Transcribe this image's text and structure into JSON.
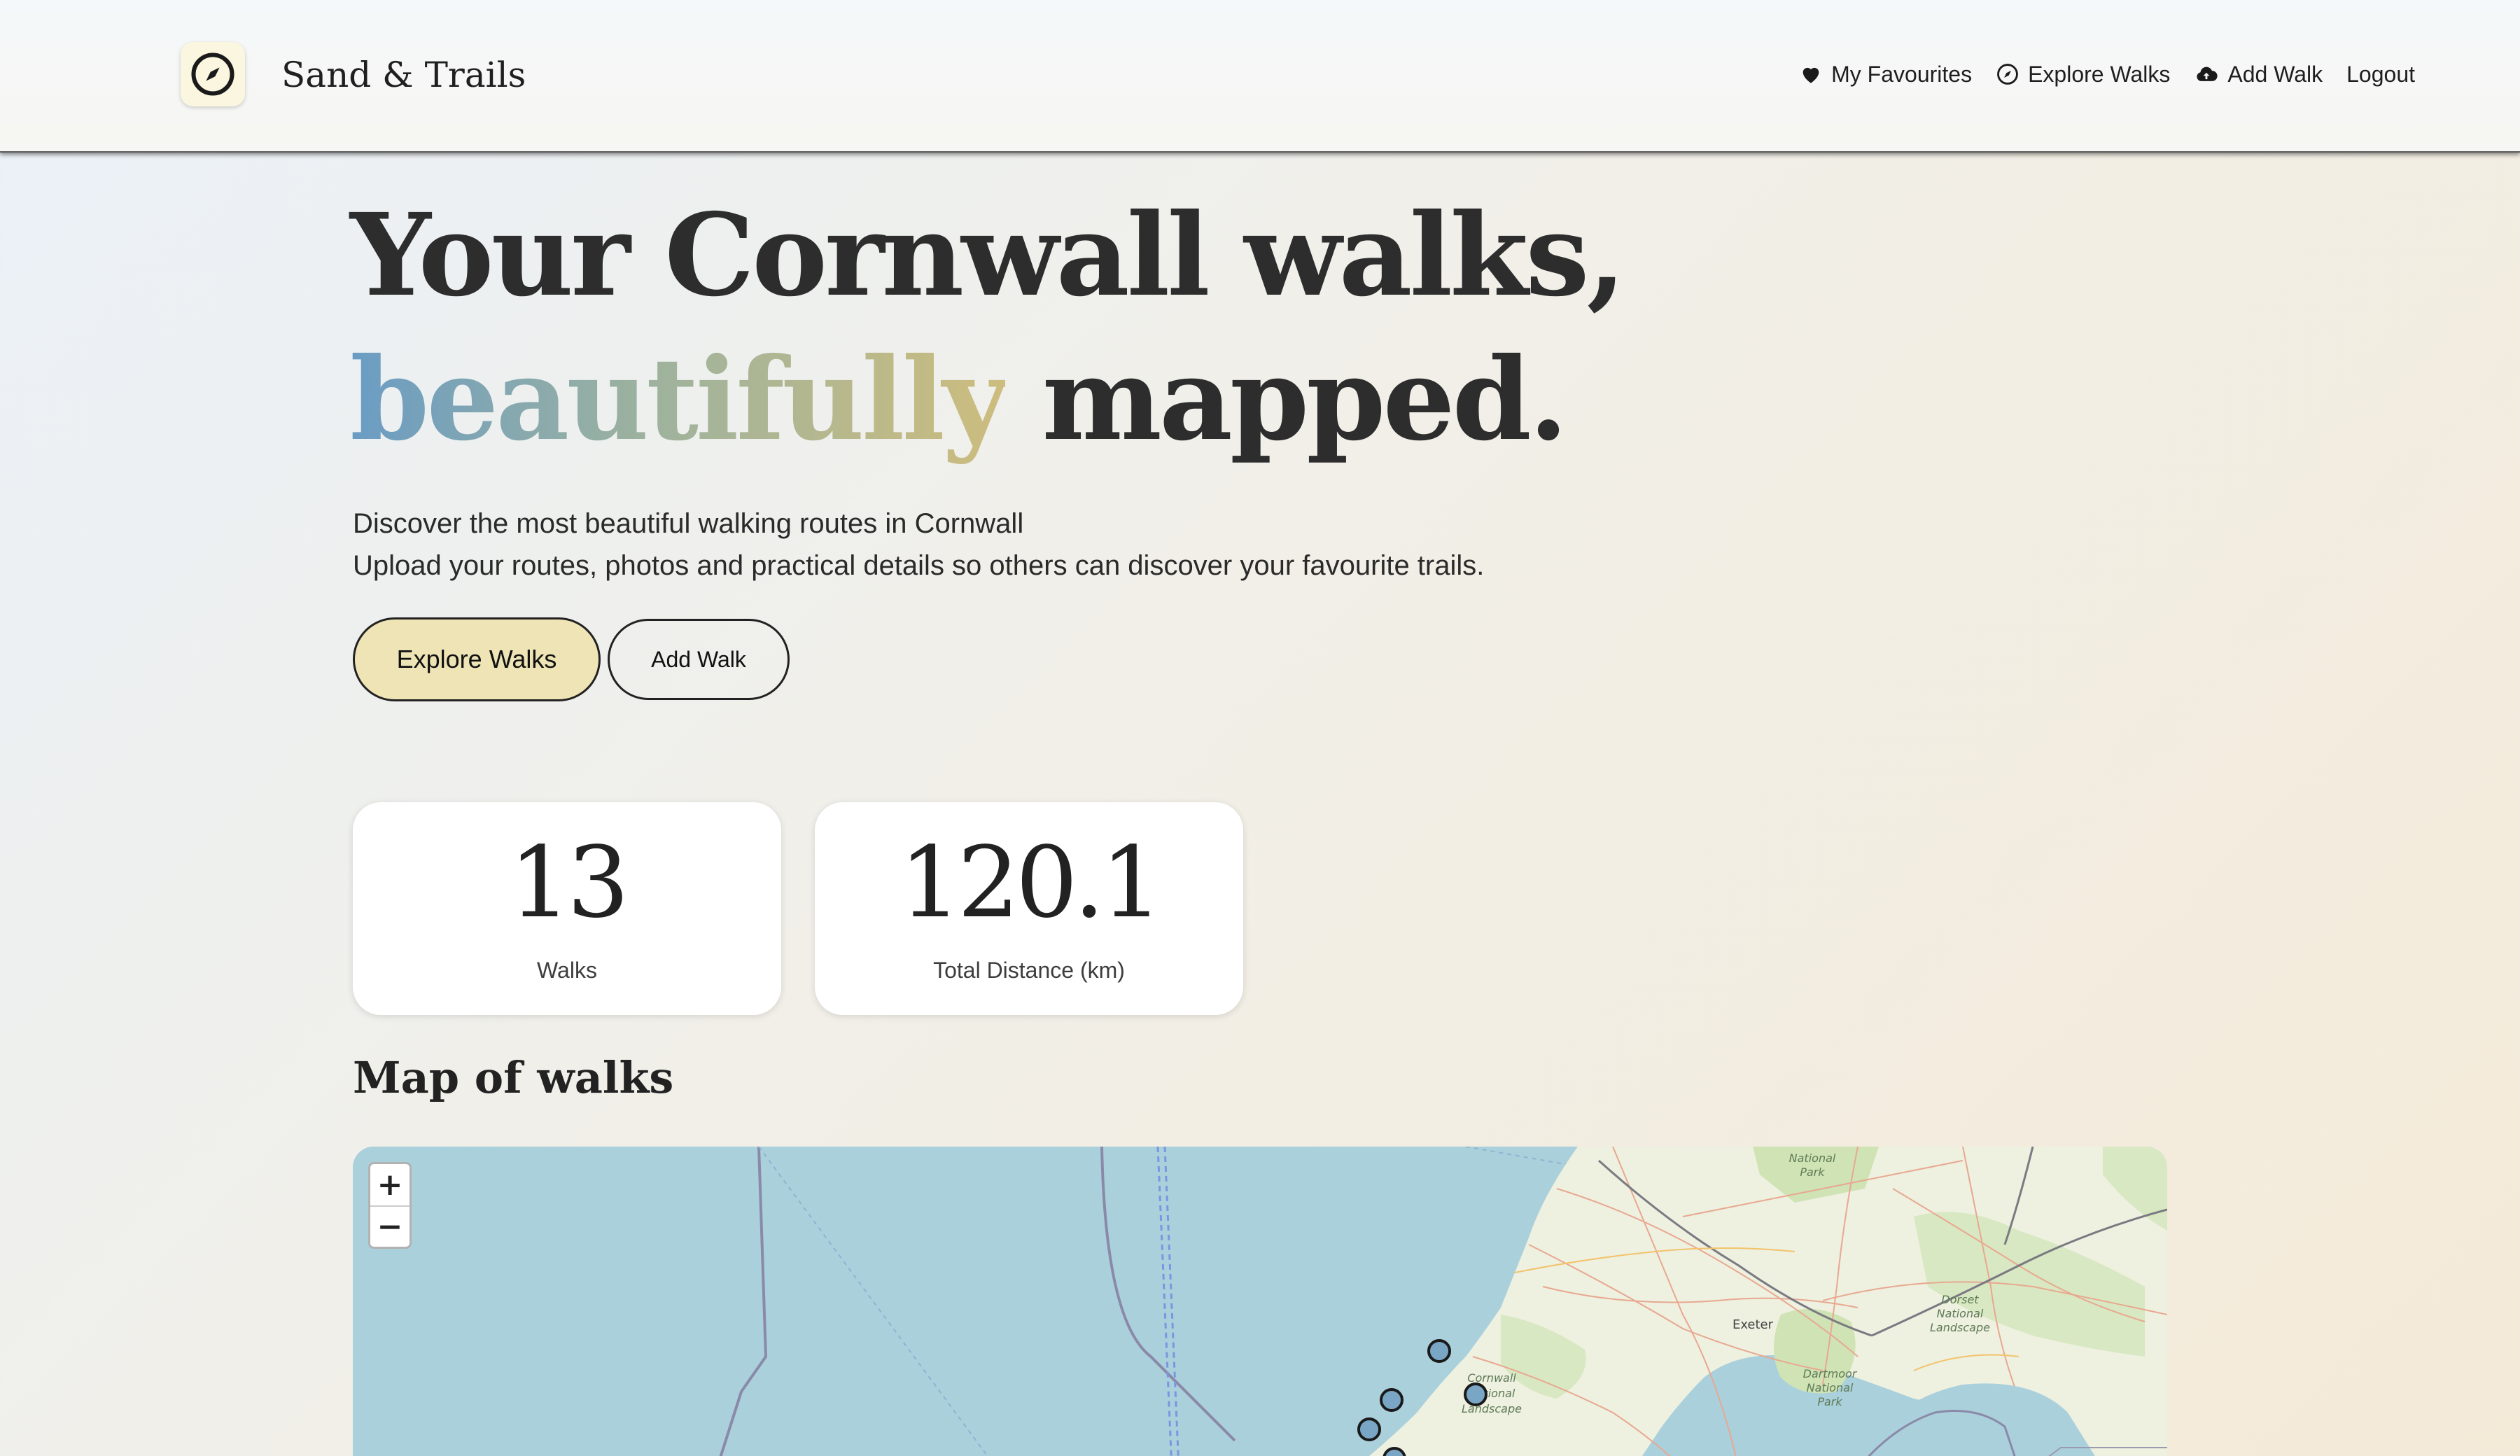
{
  "brand": {
    "name": "Sand & Trails",
    "logo_icon": "compass-icon"
  },
  "nav": {
    "favourites": {
      "label": "My Favourites",
      "icon": "heart-icon"
    },
    "explore": {
      "label": "Explore Walks",
      "icon": "compass-icon"
    },
    "add": {
      "label": "Add Walk",
      "icon": "cloud-upload-icon"
    },
    "logout": {
      "label": "Logout"
    }
  },
  "hero": {
    "title_line1": "Your Cornwall walks,",
    "title_highlight": "beautifully",
    "title_line2_rest": " mapped.",
    "subtitle_line1": "Discover the most beautiful walking routes in Cornwall",
    "subtitle_line2": "Upload your routes, photos and practical details so others can discover your favourite trails.",
    "primary_button": "Explore Walks",
    "secondary_button": "Add Walk"
  },
  "stats": {
    "walks_value": "13",
    "walks_label": "Walks",
    "distance_value": "120.1",
    "distance_label": "Total Distance (km)"
  },
  "map_section": {
    "title": "Map of walks",
    "zoom_in": "+",
    "zoom_out": "−",
    "place_labels": {
      "national_park_top": "National\nPark",
      "exeter": "Exeter",
      "dartmoor": "Dartmoor\nNational\nPark",
      "dorset": "Dorset\nNational\nLandscape",
      "cornwall": "Cornwall\nNational\nLandscape"
    }
  },
  "colors": {
    "accent_button": "#efe4b5",
    "sea": "#aad0dc",
    "land": "#eef0e0",
    "marker": "#7aa6c6",
    "gradient_start": "#6a9cc4",
    "gradient_end": "#cdbd7e"
  }
}
